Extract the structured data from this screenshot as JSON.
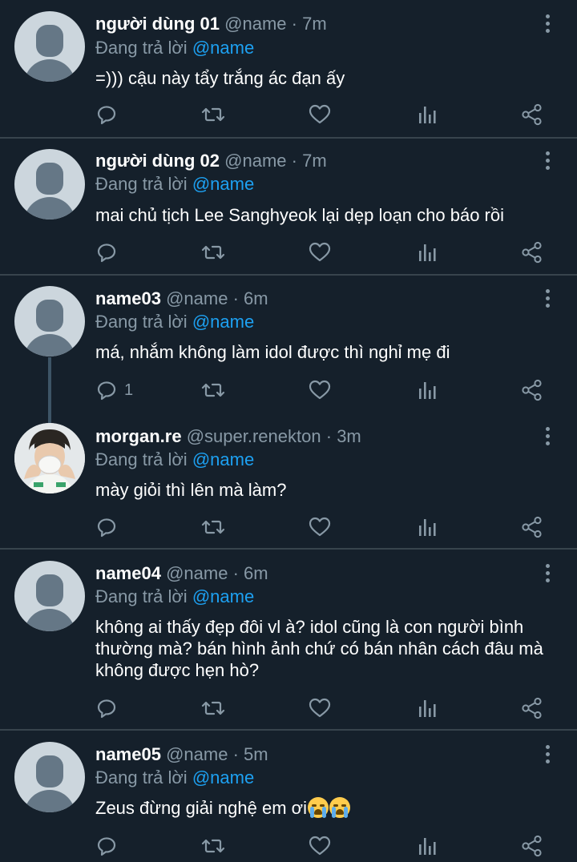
{
  "colors": {
    "background": "#15202b",
    "divider": "#38444d",
    "muted": "#8899a6",
    "accent": "#1da1f2",
    "text": "#ffffff"
  },
  "tweets": [
    {
      "display_name": "người dùng 01",
      "handle": "@name",
      "dot": "·",
      "time": "7m",
      "reply_prefix": "Đang trả lời",
      "reply_mention": "@name",
      "text": "=))) cậu này tẩy trắng ác đạn ấy",
      "reply_count": "",
      "avatar": "default-avatar-icon"
    },
    {
      "display_name": "người dùng 02",
      "handle": "@name",
      "dot": "·",
      "time": "7m",
      "reply_prefix": "Đang trả lời",
      "reply_mention": "@name",
      "text": "mai chủ tịch Lee Sanghyeok lại dẹp loạn cho báo rồi",
      "reply_count": "",
      "avatar": "default-avatar-icon"
    },
    {
      "display_name": "name03",
      "handle": "@name",
      "dot": "·",
      "time": "6m",
      "reply_prefix": "Đang trả lời",
      "reply_mention": "@name",
      "text": "má, nhắm không làm idol được thì nghỉ mẹ đi",
      "reply_count": "1",
      "avatar": "default-avatar-icon"
    },
    {
      "display_name": "morgan.re",
      "handle": "@super.renekton",
      "dot": "·",
      "time": "3m",
      "reply_prefix": "Đang trả lời",
      "reply_mention": "@name",
      "text": "mày giỏi thì lên mà làm?",
      "reply_count": "",
      "avatar": "profile-photo"
    },
    {
      "display_name": "name04",
      "handle": "@name",
      "dot": "·",
      "time": "6m",
      "reply_prefix": "Đang trả lời",
      "reply_mention": "@name",
      "text": "không ai thấy đẹp đôi vl à? idol cũng là con người bình thường mà? bán hình ảnh chứ có bán nhân cách đâu mà không được hẹn hò?",
      "reply_count": "",
      "avatar": "default-avatar-icon"
    },
    {
      "display_name": "name05",
      "handle": "@name",
      "dot": "·",
      "time": "5m",
      "reply_prefix": "Đang trả lời",
      "reply_mention": "@name",
      "text": "Zeus đừng giải nghệ em ơi",
      "reply_count": "",
      "avatar": "default-avatar-icon",
      "emojis": [
        "crying-face-icon",
        "crying-face-icon"
      ]
    }
  ],
  "action_icons": [
    "reply-icon",
    "retweet-icon",
    "like-icon",
    "analytics-icon",
    "share-icon"
  ]
}
